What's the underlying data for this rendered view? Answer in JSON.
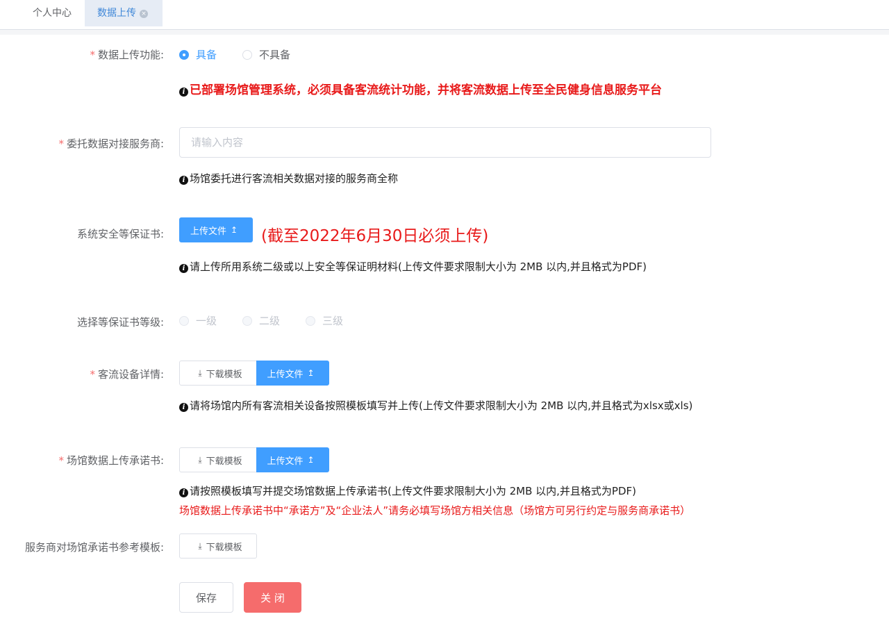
{
  "tabs": [
    {
      "label": "个人中心"
    },
    {
      "label": "数据上传",
      "close_icon": "×"
    }
  ],
  "colors": {
    "primary": "#409eff",
    "danger": "#f56c6c",
    "warning_text": "#e81a1a"
  },
  "form": {
    "upload_function": {
      "label": "数据上传功能:",
      "options": [
        "具备",
        "不具备"
      ],
      "selected": "具备",
      "hint": "已部署场馆管理系统，必须具备客流统计功能，并将客流数据上传至全民健身信息服务平台"
    },
    "service_provider": {
      "label": "委托数据对接服务商:",
      "placeholder": "请输入内容",
      "value": "",
      "hint": "场馆委托进行客流相关数据对接的服务商全称"
    },
    "security_cert": {
      "label": "系统安全等保证书:",
      "upload_label": "上传文件",
      "deadline": "(截至2022年6月30日必须上传)",
      "hint": "请上传所用系统二级或以上安全等保证明材料(上传文件要求限制大小为 2MB 以内,并且格式为PDF)"
    },
    "cert_level": {
      "label": "选择等保证书等级:",
      "options": [
        "一级",
        "二级",
        "三级"
      ]
    },
    "device_details": {
      "label": "客流设备详情:",
      "download_label": "下载模板",
      "upload_label": "上传文件",
      "hint": "请将场馆内所有客流相关设备按照模板填写并上传(上传文件要求限制大小为 2MB 以内,并且格式为xlsx或xls)"
    },
    "commitment": {
      "label": "场馆数据上传承诺书:",
      "download_label": "下载模板",
      "upload_label": "上传文件",
      "hint": "请按照模板填写并提交场馆数据上传承诺书(上传文件要求限制大小为 2MB 以内,并且格式为PDF)",
      "note": "场馆数据上传承诺书中“承诺方”及“企业法人”请务必填写场馆方相关信息（场馆方可另行约定与服务商承诺书）"
    },
    "reference_template": {
      "label": "服务商对场馆承诺书参考模板:",
      "download_label": "下载模板"
    },
    "actions": {
      "save": "保存",
      "close": "关 闭"
    }
  },
  "icons": {
    "download": "download-icon",
    "upload": "upload-icon",
    "info": "info-icon"
  }
}
